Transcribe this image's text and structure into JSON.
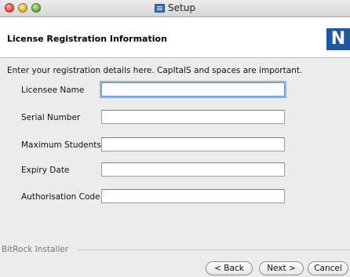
{
  "window": {
    "title": "Setup",
    "controls": [
      "×",
      "–",
      "+"
    ]
  },
  "header": {
    "title": "License Registration Information",
    "logo_text": "N"
  },
  "form": {
    "instructions": "Enter your registration details here. CapItalS and spaces are important.",
    "fields": [
      {
        "label": "Licensee Name",
        "value": "",
        "focused": true
      },
      {
        "label": "Serial Number",
        "value": ""
      },
      {
        "label": "Maximum Students",
        "value": ""
      },
      {
        "label": "Expiry Date",
        "value": ""
      },
      {
        "label": "Authorisation Code",
        "value": ""
      }
    ]
  },
  "footer": {
    "brand": "BitRock Installer",
    "back_label": "< Back",
    "next_label": "Next >",
    "cancel_label": "Cancel"
  },
  "colors": {
    "logo_bg": "#1f56a8",
    "focus_ring": "#8cb3ee",
    "window_bg": "#ececec"
  }
}
